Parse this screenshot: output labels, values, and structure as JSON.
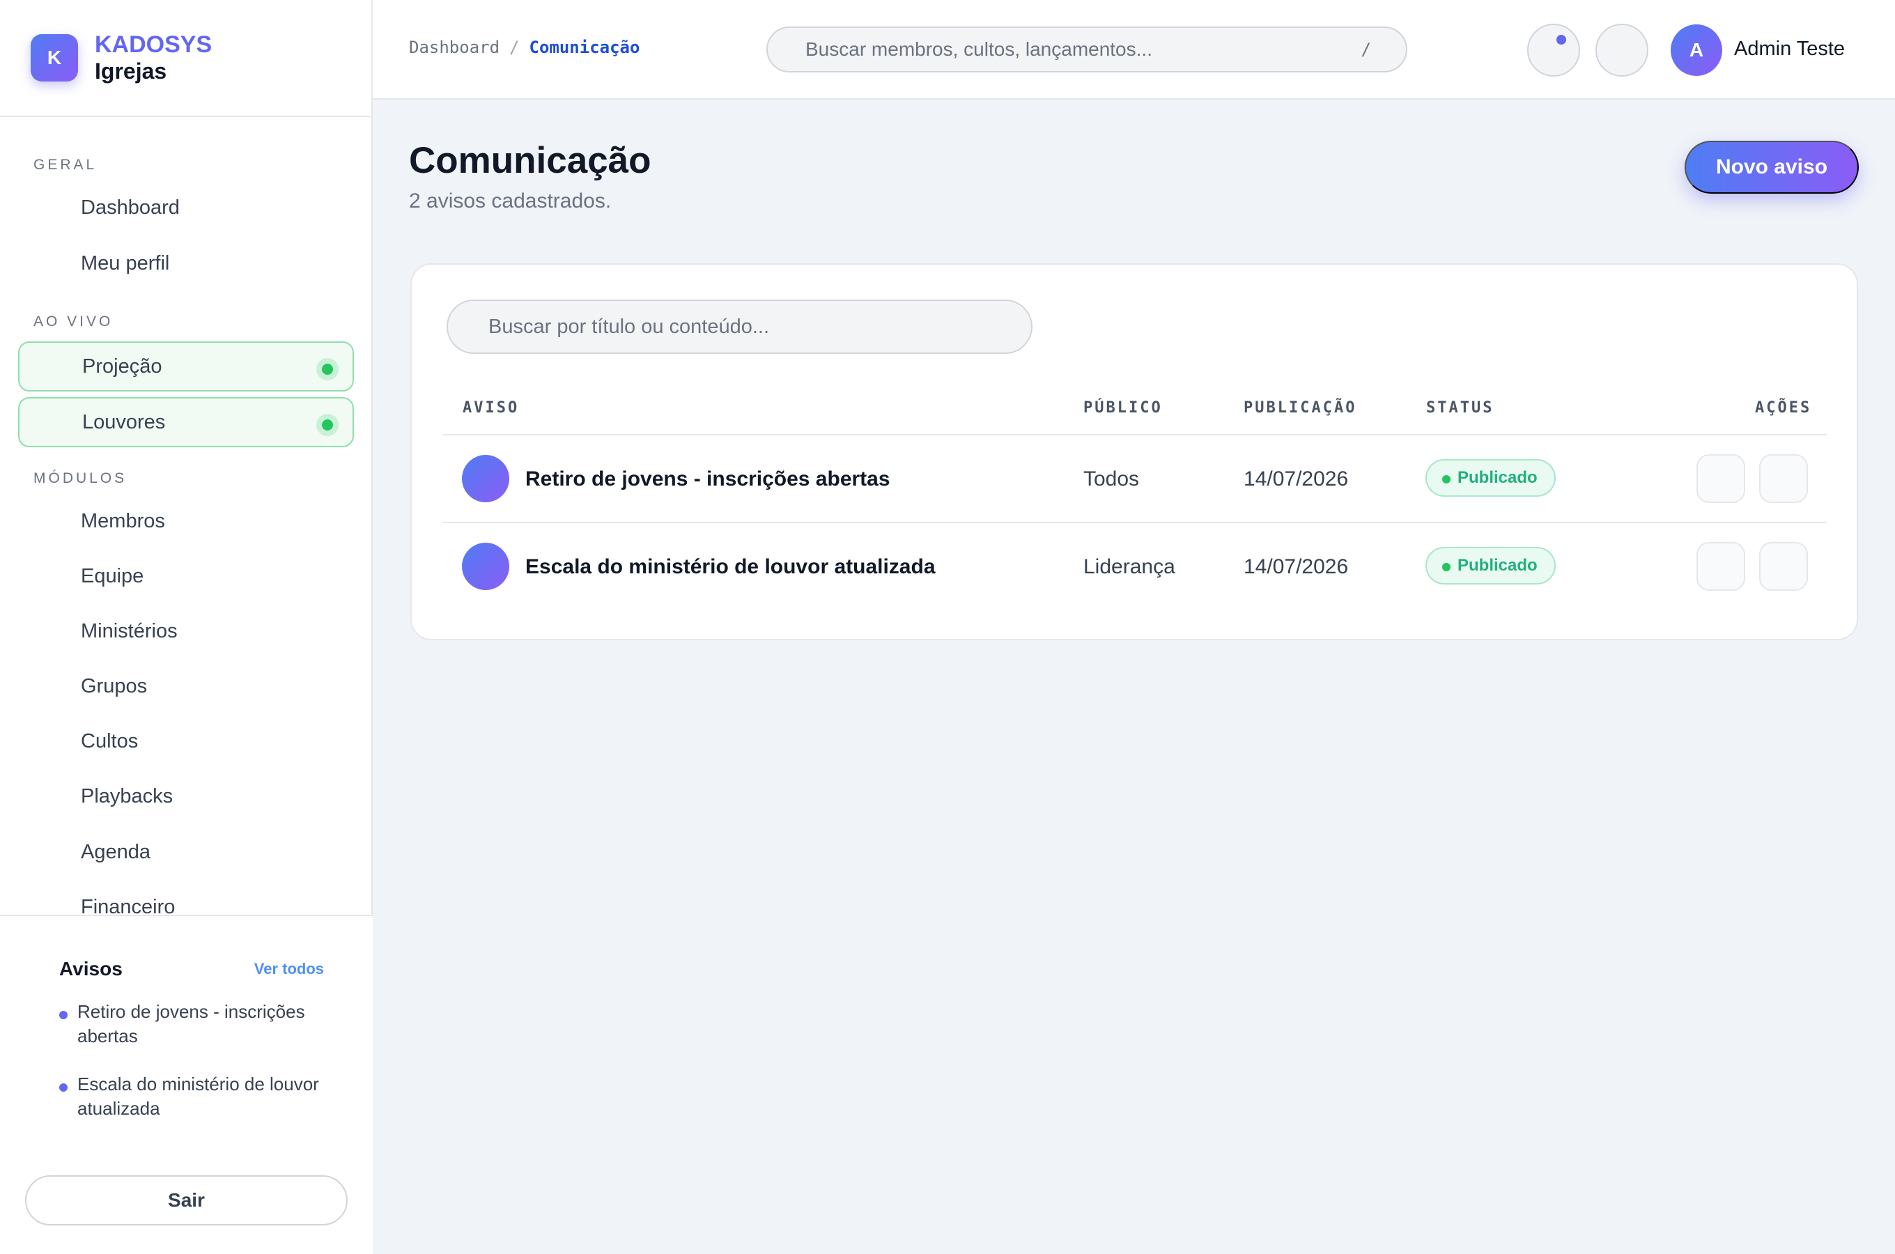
{
  "brand": {
    "name": "KADOSYS",
    "subtitle": "Igrejas",
    "logo_letter": "K"
  },
  "sidebar": {
    "sections": [
      {
        "label": "GERAL",
        "items": [
          {
            "label": "Dashboard"
          },
          {
            "label": "Meu perfil"
          }
        ]
      },
      {
        "label": "AO VIVO",
        "items": [
          {
            "label": "Projeção",
            "live": true
          },
          {
            "label": "Louvores",
            "live": true
          }
        ]
      },
      {
        "label": "MÓDULOS",
        "items": [
          {
            "label": "Membros"
          },
          {
            "label": "Equipe"
          },
          {
            "label": "Ministérios"
          },
          {
            "label": "Grupos"
          },
          {
            "label": "Cultos"
          },
          {
            "label": "Playbacks"
          },
          {
            "label": "Agenda"
          },
          {
            "label": "Financeiro"
          }
        ]
      }
    ],
    "avisos": {
      "title": "Avisos",
      "link": "Ver todos",
      "items": [
        "Retiro de jovens - inscrições abertas",
        "Escala do ministério de louvor atualizada"
      ]
    },
    "logout_label": "Sair"
  },
  "header": {
    "breadcrumb": {
      "root": "Dashboard",
      "separator": "/",
      "current": "Comunicação"
    },
    "search": {
      "placeholder": "Buscar membros, cultos, lançamentos...",
      "shortcut": "/"
    },
    "user": {
      "initial": "A",
      "name": "Admin Teste"
    }
  },
  "main": {
    "title": "Comunicação",
    "subtitle": "2 avisos cadastrados.",
    "new_button": "Novo aviso",
    "search_placeholder": "Buscar por título ou conteúdo...",
    "columns": [
      "AVISO",
      "PÚBLICO",
      "PUBLICAÇÃO",
      "STATUS",
      "AÇÕES"
    ],
    "rows": [
      {
        "title": "Retiro de jovens - inscrições abertas",
        "audience": "Todos",
        "date": "14/07/2026",
        "status": "Publicado"
      },
      {
        "title": "Escala do ministério de louvor atualizada",
        "audience": "Liderança",
        "date": "14/07/2026",
        "status": "Publicado"
      }
    ]
  },
  "colors": {
    "accent": "#6366f1",
    "accent_blue": "#4f7df3",
    "success": "#22c55e",
    "link": "#1d4ed8"
  }
}
